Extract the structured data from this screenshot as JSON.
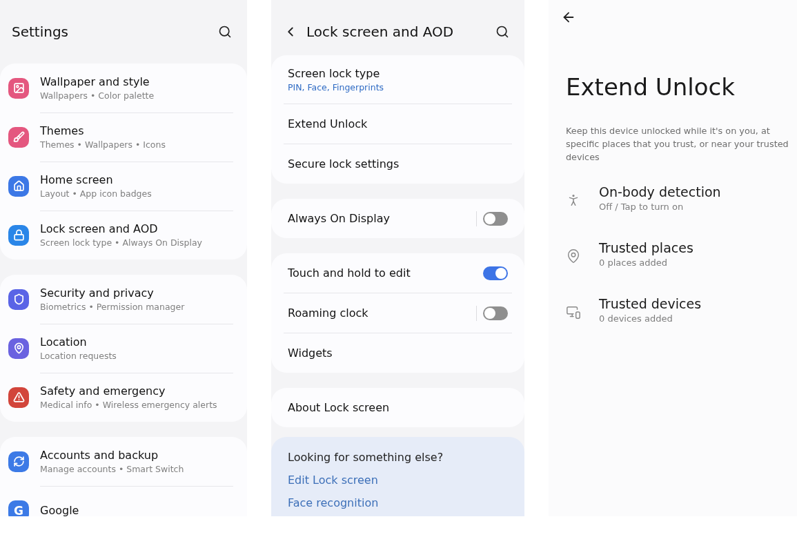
{
  "settings": {
    "title": "Settings",
    "groups": [
      {
        "items": [
          {
            "kind": "image",
            "color": "#e4577f",
            "title": "Wallpaper and style",
            "subtitle": "Wallpapers • Color palette"
          },
          {
            "kind": "brush",
            "color": "#e4577f",
            "title": "Themes",
            "subtitle": "Themes • Wallpapers • Icons"
          },
          {
            "kind": "home",
            "color": "#3c78e6",
            "title": "Home screen",
            "subtitle": "Layout • App icon badges"
          },
          {
            "kind": "lock",
            "color": "#2a86e8",
            "title": "Lock screen and AOD",
            "subtitle": "Screen lock type • Always On Display"
          }
        ]
      },
      {
        "items": [
          {
            "kind": "shield",
            "color": "#5a64e6",
            "title": "Security and privacy",
            "subtitle": "Biometrics • Permission manager"
          },
          {
            "kind": "pin",
            "color": "#6a62e0",
            "title": "Location",
            "subtitle": "Location requests"
          },
          {
            "kind": "alert",
            "color": "#d2453b",
            "title": "Safety and emergency",
            "subtitle": "Medical info • Wireless emergency alerts"
          }
        ]
      },
      {
        "items": [
          {
            "kind": "sync",
            "color": "#3c7ae6",
            "title": "Accounts and backup",
            "subtitle": "Manage accounts • Smart Switch"
          },
          {
            "kind": "letter",
            "badge": "G",
            "color": "#3c7ae6",
            "title": "Google"
          }
        ]
      }
    ]
  },
  "lock_screen": {
    "title": "Lock screen and AOD",
    "groups": [
      {
        "items": [
          {
            "kind": "detail",
            "title": "Screen lock type",
            "subtitle": "PIN, Face, Fingerprints"
          },
          {
            "kind": "plain",
            "title": "Extend Unlock"
          },
          {
            "kind": "plain",
            "title": "Secure lock settings"
          }
        ]
      },
      {
        "items": [
          {
            "kind": "toggle",
            "title": "Always On Display",
            "on": false
          }
        ]
      },
      {
        "items": [
          {
            "kind": "toggle",
            "title": "Touch and hold to edit",
            "on": true
          },
          {
            "kind": "toggle",
            "title": "Roaming clock",
            "on": false
          },
          {
            "kind": "plain",
            "title": "Widgets"
          }
        ]
      },
      {
        "items": [
          {
            "kind": "plain",
            "title": "About Lock screen"
          }
        ]
      }
    ],
    "suggestions": {
      "heading": "Looking for something else?",
      "links": [
        "Edit Lock screen",
        "Face recognition"
      ]
    }
  },
  "extend_unlock": {
    "title": "Extend Unlock",
    "description": "Keep this device unlocked while it's on you, at specific places that you trust, or near your trusted devices",
    "options": [
      {
        "kind": "walk",
        "title": "On-body detection",
        "subtitle": "Off / Tap to turn on"
      },
      {
        "kind": "pin",
        "title": "Trusted places",
        "subtitle": "0 places added"
      },
      {
        "kind": "devices",
        "title": "Trusted devices",
        "subtitle": "0 devices added"
      }
    ]
  }
}
